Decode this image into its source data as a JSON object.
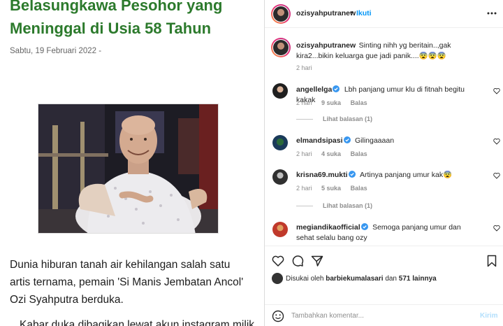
{
  "article": {
    "title_line1": "Belasungkawa Pesohor yang",
    "title_line2": "Meninggal di Usia 58 Tahun",
    "date": "Sabtu, 19 Februari 2022  -",
    "paragraph1": "Dunia hiburan tanah air kehilangan salah satu artis ternama, pemain 'Si Manis Jembatan Ancol' Ozi Syahputra berduka.",
    "paragraph2": "Kabar duka dibagikan lewat akun instagram milik"
  },
  "instagram": {
    "header": {
      "username": "ozisyahputranew",
      "dot": "•",
      "follow_label": "Ikuti"
    },
    "caption": {
      "username": "ozisyahputranew",
      "text": "Sinting nihh yg beritain..,gak kira2...bikin keluarga gue jadi panik....😨😨😨",
      "time": "2 hari"
    },
    "comments": [
      {
        "username": "angellelga",
        "verified": true,
        "text": "Lbh panjang umur klu di fitnah begitu kakak",
        "time": "2 hari",
        "likes": "9 suka",
        "reply": "Balas",
        "view_replies": "Lihat balasan (1)"
      },
      {
        "username": "elmandsipasi",
        "verified": true,
        "text": "Gilingaaaan",
        "time": "2 hari",
        "likes": "4 suka",
        "reply": "Balas"
      },
      {
        "username": "krisna69.mukti",
        "verified": true,
        "text": "Artinya panjang umur kak😨",
        "time": "2 hari",
        "likes": "5 suka",
        "reply": "Balas",
        "view_replies": "Lihat balasan (1)"
      },
      {
        "username": "megiandikaofficial",
        "verified": true,
        "text": "Semoga panjang umur dan sehat selalu bang ozy"
      }
    ],
    "likes": {
      "prefix": "Disukai oleh",
      "user": "barbiekumalasari",
      "middle": "dan",
      "others": "571 lainnya"
    },
    "add_comment": {
      "placeholder": "Tambahkan komentar...",
      "post_label": "Kirim"
    },
    "colors": {
      "link_blue": "#0095f6",
      "verified_blue": "#3897f0",
      "muted": "#8e8e8e",
      "title_green": "#2c7a2c"
    }
  }
}
